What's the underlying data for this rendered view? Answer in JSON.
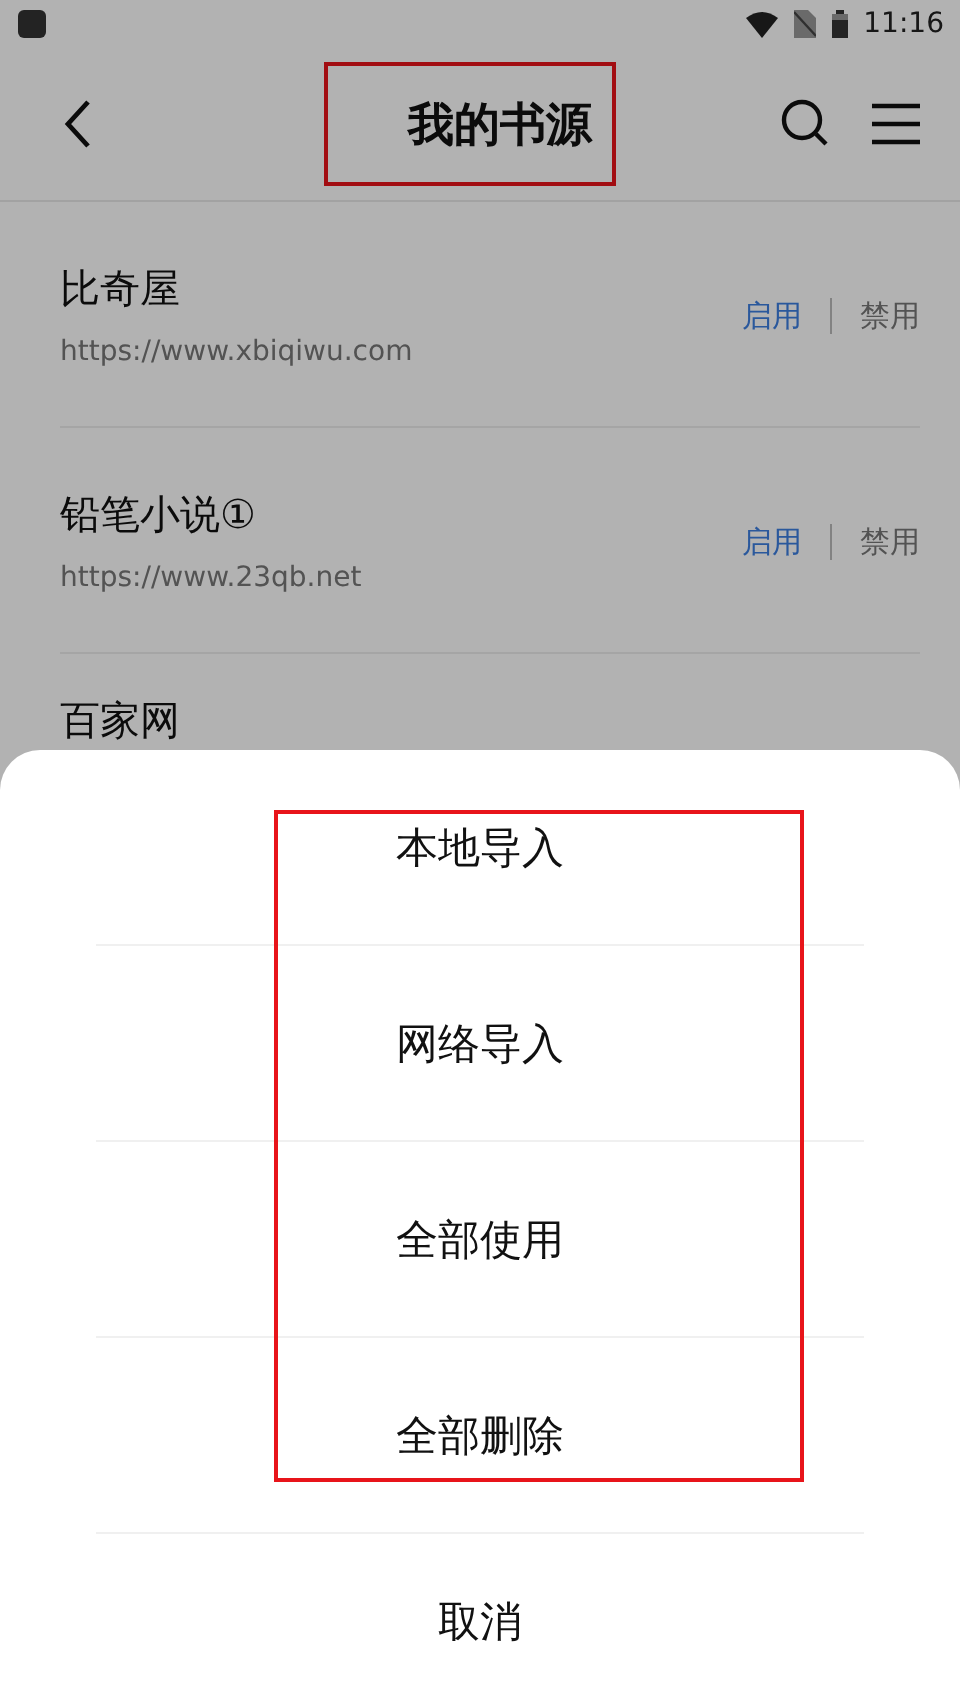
{
  "status_bar": {
    "time": "11:16"
  },
  "header": {
    "title": "我的书源",
    "highlighted": true
  },
  "sources": [
    {
      "name": "比奇屋",
      "url": "https://www.xbiqiwu.com",
      "actions": [
        {
          "label": "启用",
          "kind": "enable"
        },
        {
          "label": "禁用",
          "kind": "disable"
        }
      ]
    },
    {
      "name": "铅笔小说①",
      "url": "https://www.23qb.net",
      "actions": [
        {
          "label": "启用",
          "kind": "enable"
        },
        {
          "label": "禁用",
          "kind": "disable"
        }
      ]
    },
    {
      "name": "百家网"
    }
  ],
  "sheet": {
    "options_highlighted": true,
    "options": [
      "本地导入",
      "网络导入",
      "全部使用",
      "全部删除"
    ],
    "cancel": "取消"
  }
}
